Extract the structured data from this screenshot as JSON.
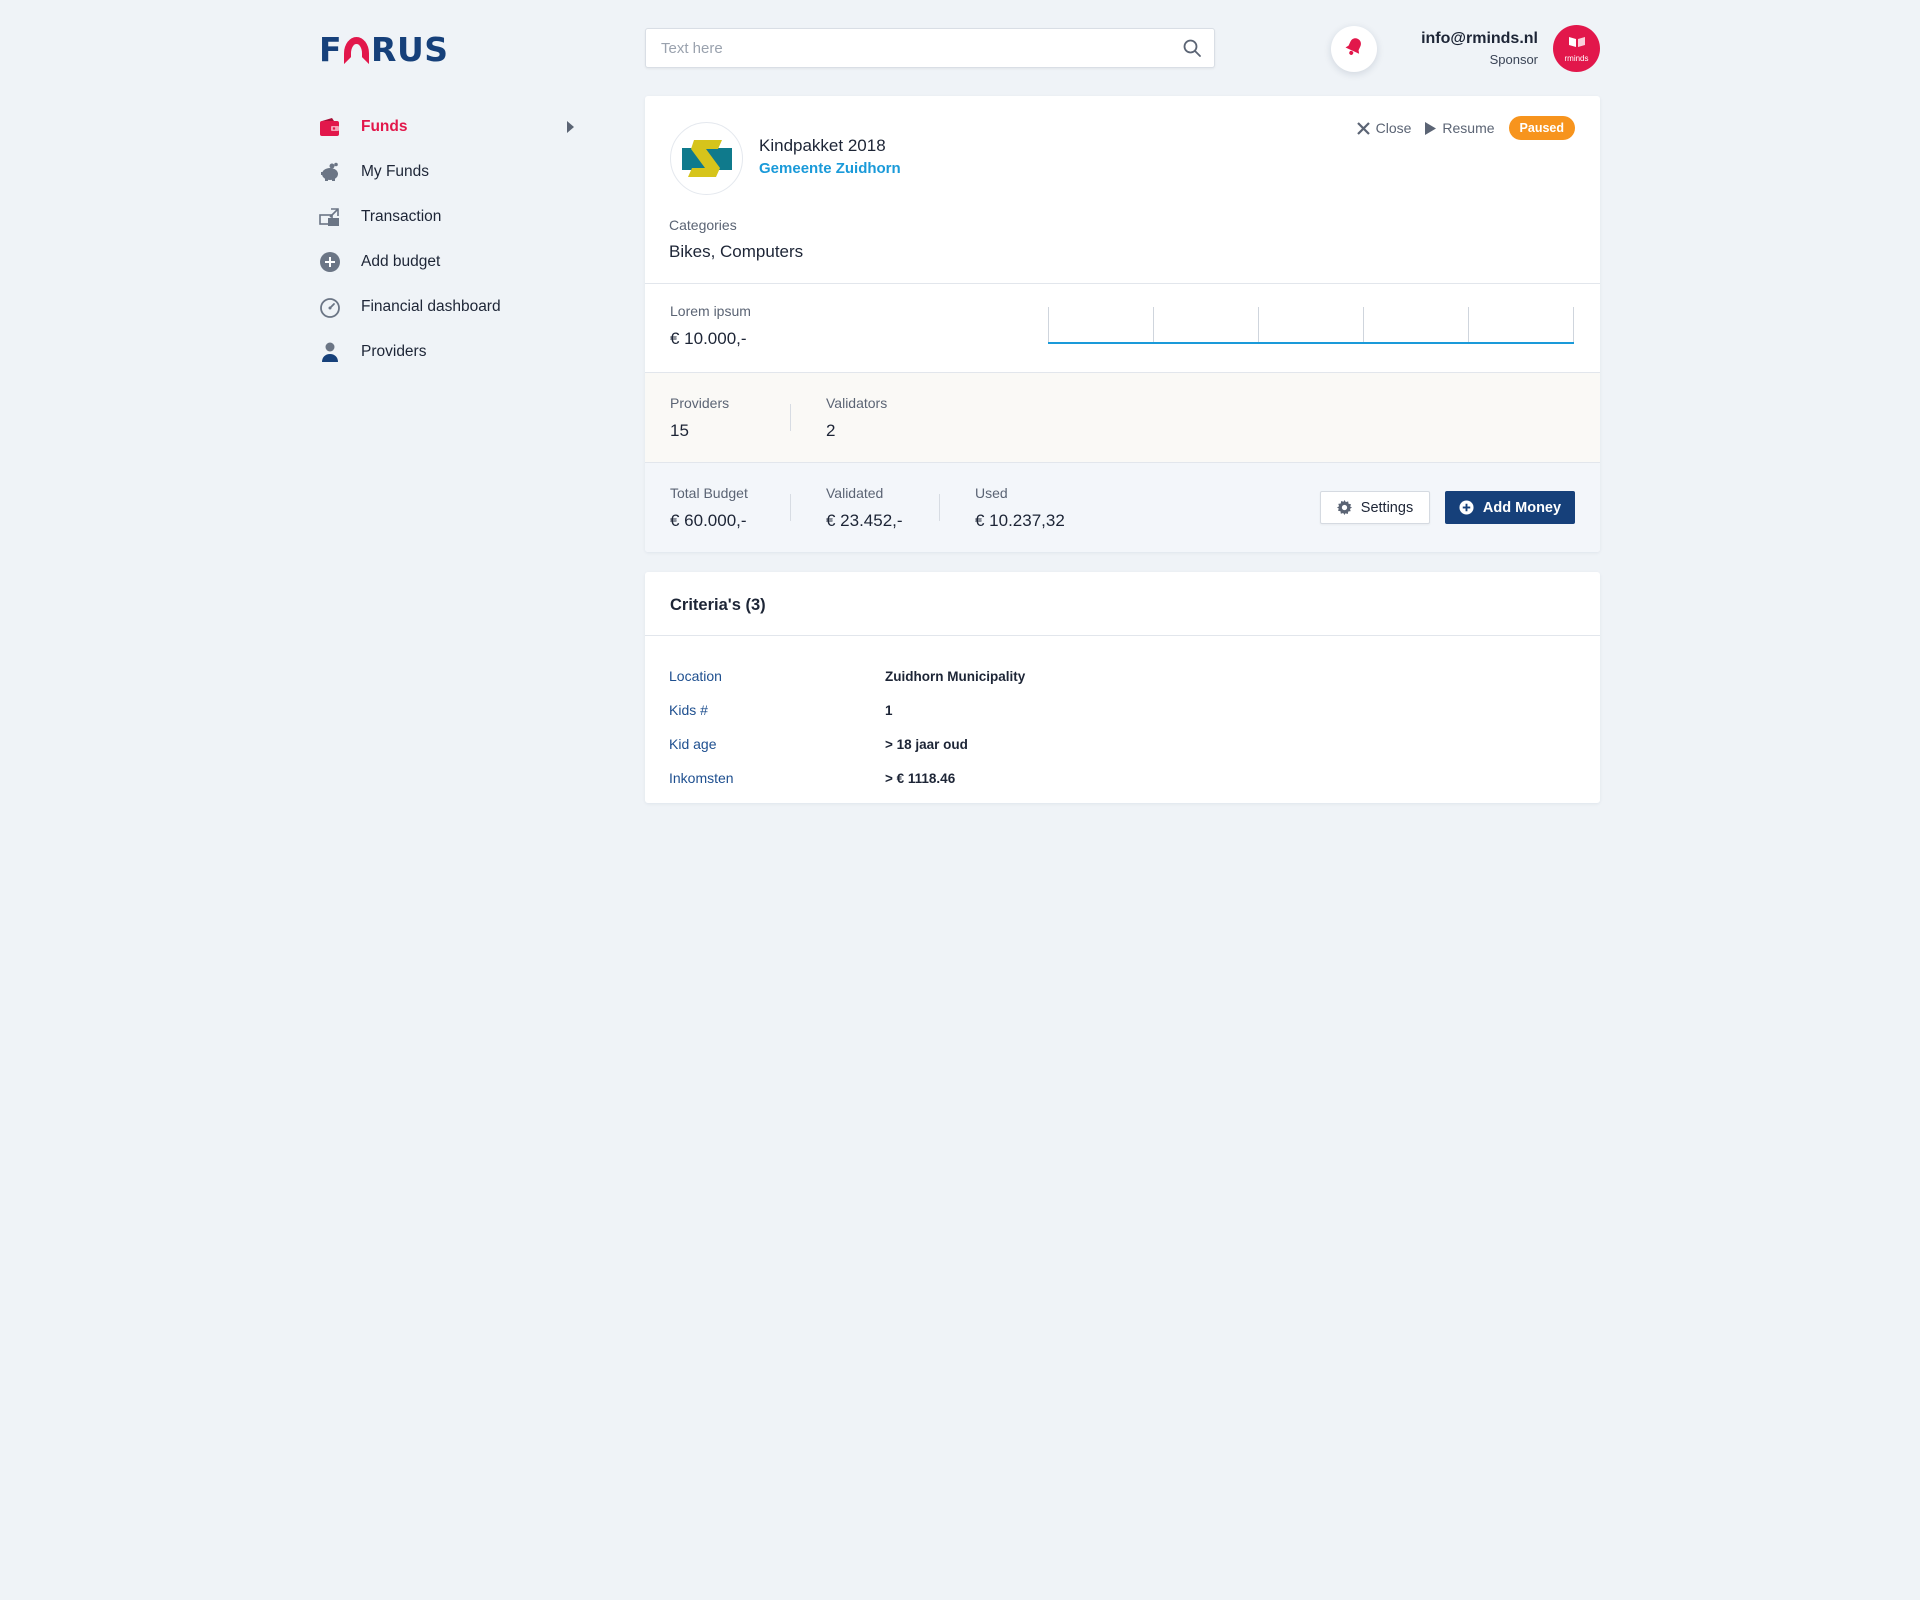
{
  "brand": {
    "logo_left": "F",
    "logo_right": "RUS"
  },
  "search": {
    "placeholder": "Text here",
    "value": ""
  },
  "user": {
    "email": "info@rminds.nl",
    "role": "Sponsor",
    "avatar_text": "rminds"
  },
  "sidebar": {
    "items": [
      {
        "label": "Funds",
        "icon": "wallet-icon",
        "active": true
      },
      {
        "label": "My Funds",
        "icon": "piggy-bank-icon",
        "active": false
      },
      {
        "label": "Transaction",
        "icon": "transaction-icon",
        "active": false
      },
      {
        "label": "Add budget",
        "icon": "plus-circle-icon",
        "active": false
      },
      {
        "label": "Financial dashboard",
        "icon": "dashboard-gauge-icon",
        "active": false
      },
      {
        "label": "Providers",
        "icon": "person-icon",
        "active": false
      }
    ]
  },
  "fund": {
    "name": "Kindpakket 2018",
    "organization": "Gemeente Zuidhorn",
    "actions": {
      "close": "Close",
      "resume": "Resume"
    },
    "status": "Paused",
    "categories_label": "Categories",
    "categories": "Bikes, Computers",
    "graph": {
      "label": "Lorem ipsum",
      "value": "€ 10.000,-"
    },
    "stats": [
      {
        "label": "Providers",
        "value": "15"
      },
      {
        "label": "Validators",
        "value": "2"
      }
    ],
    "budget": [
      {
        "label": "Total Budget",
        "value": "€ 60.000,-"
      },
      {
        "label": "Validated",
        "value": "€ 23.452,-"
      },
      {
        "label": "Used",
        "value": "€ 10.237,32"
      }
    ],
    "buttons": {
      "settings": "Settings",
      "add_money": "Add Money"
    }
  },
  "criteria": {
    "title": "Criteria's (3)",
    "rows": [
      {
        "key": "Location",
        "value": "Zuidhorn Municipality"
      },
      {
        "key": "Kids #",
        "value": "1"
      },
      {
        "key": "Kid age",
        "value": "> 18 jaar oud"
      },
      {
        "key": "Inkomsten",
        "value": "> € 1118.46"
      }
    ]
  },
  "colors": {
    "brand_navy": "#16407a",
    "brand_red": "#e2174b",
    "link_blue": "#1a9ad9",
    "status_paused": "#f7941d",
    "page_bg": "#eff3f7"
  }
}
